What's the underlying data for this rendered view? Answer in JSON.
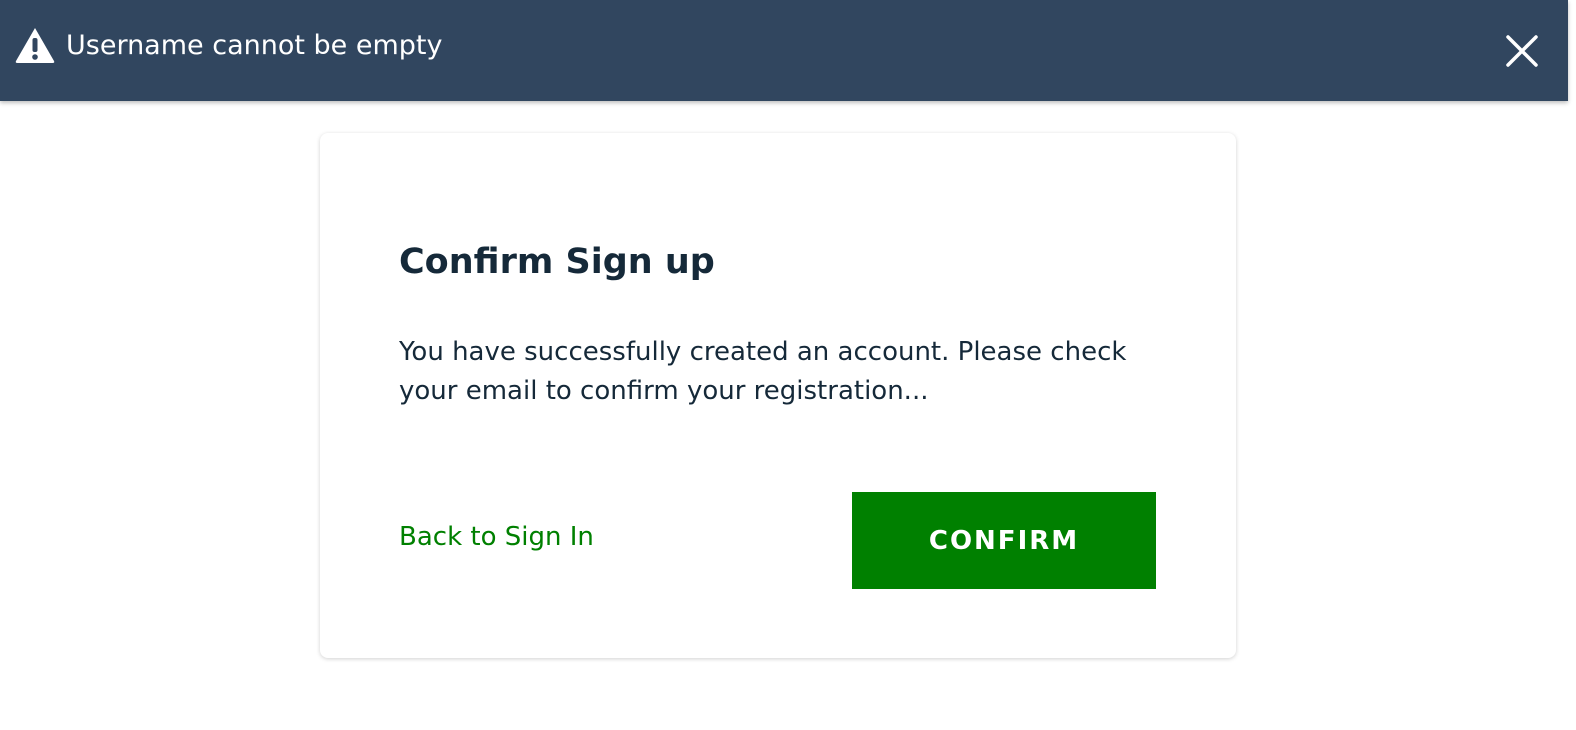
{
  "toast": {
    "icon": "warning-icon",
    "message": "Username cannot be empty",
    "close_icon": "close-icon",
    "background_color": "#31465f"
  },
  "confirm_signup": {
    "title": "Confirm Sign up",
    "message": "You have successfully created an account. Please check your email to confirm your registration...",
    "back_link_label": "Back to Sign In",
    "confirm_button_label": "CONFIRM"
  },
  "colors": {
    "accent": "#008000",
    "text": "#152939",
    "toast_text": "#ffffff"
  }
}
